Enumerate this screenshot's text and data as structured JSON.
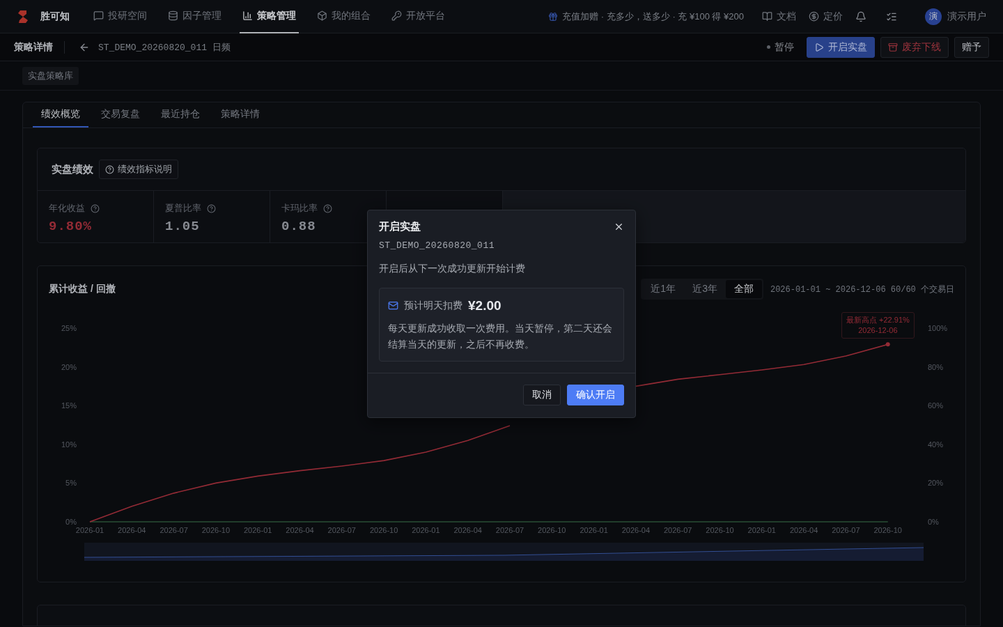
{
  "top_nav": {
    "brand": "胜可知",
    "items": [
      {
        "label": "投研空间",
        "selected": false
      },
      {
        "label": "因子管理",
        "selected": false
      },
      {
        "label": "策略管理",
        "selected": true
      },
      {
        "label": "我的组合",
        "selected": false
      },
      {
        "label": "开放平台",
        "selected": false
      }
    ],
    "promo": "充值加赠 · 充多少，送多少 · 充 ¥100 得 ¥200",
    "links": [
      "文档",
      "定价"
    ],
    "user": {
      "avatar": "演",
      "name": "演示用户"
    }
  },
  "sub_header": {
    "title": "策略详情",
    "strategy": "ST_DEMO_20260820_011 日频",
    "status": "暂停",
    "buttons": [
      {
        "label": "开启实盘",
        "kind": "primary"
      },
      {
        "label": "废弃下线",
        "kind": "danger"
      },
      {
        "label": "赠予",
        "kind": "default"
      }
    ]
  },
  "breadcrumb": "实盘策略库",
  "tabs": [
    {
      "label": "绩效概览",
      "selected": true
    },
    {
      "label": "交易复盘",
      "selected": false
    },
    {
      "label": "最近持仓",
      "selected": false
    },
    {
      "label": "策略详情",
      "selected": false
    }
  ],
  "performance": {
    "title": "实盘绩效",
    "help_button": "绩效指标说明",
    "metrics": [
      {
        "label": "年化收益",
        "value": "9.80%",
        "highlighted": true
      },
      {
        "label": "夏普比率",
        "value": "1.05",
        "highlighted": false
      },
      {
        "label": "卡玛比率",
        "value": "0.88",
        "highlighted": false
      }
    ]
  },
  "chart": {
    "title": "累计收益 / 回撤",
    "ranges": [
      {
        "label": "近1年",
        "selected": false
      },
      {
        "label": "近3年",
        "selected": false
      },
      {
        "label": "全部",
        "selected": true
      }
    ],
    "range_info": "2026-01-01 ~ 2026-12-06 60/60 个交易日",
    "right_axis": [
      "100%",
      "80%",
      "60%",
      "40%",
      "20%",
      "0%"
    ],
    "peak_label": "最新高点 +22.91%",
    "peak_date": "2026-12-06",
    "chart_data": {
      "type": "line",
      "categories": [
        "2026-01",
        "2026-04",
        "2026-07",
        "2026-10",
        "2026-01",
        "2026-04",
        "2026-07",
        "2026-10",
        "2026-01",
        "2026-04",
        "2026-07",
        "2026-10",
        "2026-01",
        "2026-04",
        "2026-07",
        "2026-10",
        "2026-01",
        "2026-04",
        "2026-07",
        "2026-10"
      ],
      "series": [
        {
          "color": "#a8313d",
          "values": [
            0,
            2.0,
            3.7,
            5.0,
            5.9,
            6.6,
            7.2,
            7.9,
            9.0,
            10.5,
            12.4,
            null,
            null,
            17.5,
            18.4,
            19.0,
            19.6,
            20.3,
            21.4,
            22.9
          ]
        },
        {
          "color": "#2f5a3e",
          "values": [
            0,
            0,
            0,
            0,
            0,
            0,
            0,
            0,
            0,
            0,
            0,
            0,
            0,
            0,
            0,
            0,
            0,
            0,
            0,
            0
          ]
        }
      ],
      "ylim": [
        0,
        25
      ],
      "yticks": [
        {
          "value": 0,
          "label": "0%"
        },
        {
          "value": 5,
          "label": "5%"
        },
        {
          "value": 10,
          "label": "10%"
        },
        {
          "value": 15,
          "label": "15%"
        },
        {
          "value": 20,
          "label": "20%"
        },
        {
          "value": 25,
          "label": "25%"
        }
      ]
    }
  },
  "modal": {
    "title": "开启实盘",
    "subtitle": "ST_DEMO_20260820_011",
    "description": "开启后从下一次成功更新开始计费",
    "fee_label": "预计明天扣费",
    "fee_amount": "¥2.00",
    "note": "每天更新成功收取一次费用。当天暂停，第二天还会结算当天的更新，之后不再收费。",
    "buttons": [
      {
        "label": "取消",
        "kind": "default"
      },
      {
        "label": "确认开启",
        "kind": "primary"
      }
    ]
  }
}
